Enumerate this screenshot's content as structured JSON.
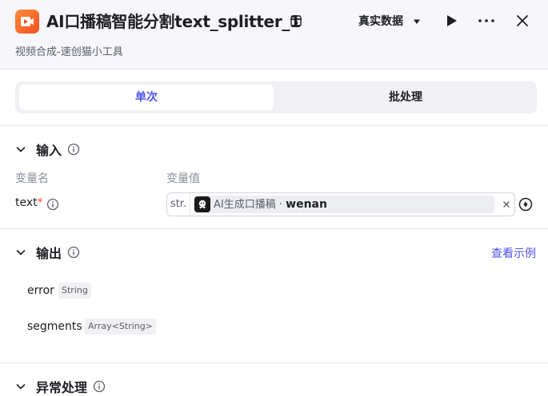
{
  "header": {
    "title": "AI口播稿智能分割text_splitter_1",
    "subtitle": "视频合成-速创猫小工具",
    "mode": "真实数据",
    "icons": {
      "app": "video-app-icon",
      "tag": "shop-icon",
      "run": "play-icon",
      "more": "more-icon",
      "close": "close-icon"
    }
  },
  "tabs": [
    {
      "label": "单次",
      "active": true
    },
    {
      "label": "批处理",
      "active": false
    }
  ],
  "input": {
    "title": "输入",
    "col_name": "变量名",
    "col_value": "变量值",
    "params": [
      {
        "name": "text",
        "required_mark": "*",
        "type": "str.",
        "ref_node": "AI生成口播稿",
        "ref_sep": " · ",
        "ref_var": "wenan"
      }
    ]
  },
  "output": {
    "title": "输出",
    "example_link": "查看示例",
    "fields": [
      {
        "name": "error",
        "type": "String"
      },
      {
        "name": "segments",
        "type": "Array<String>"
      }
    ]
  },
  "exception": {
    "title": "异常处理"
  },
  "colors": {
    "accent": "#4d53e8",
    "required": "#f54a45",
    "app_icon": "#f4511e"
  }
}
